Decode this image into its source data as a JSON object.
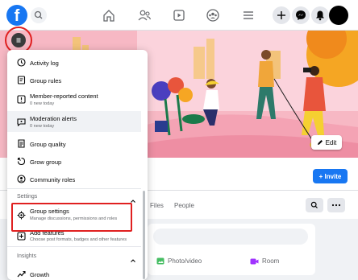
{
  "topbar": {
    "logo_letter": "f",
    "icons": [
      "search-icon",
      "home-icon",
      "friends-icon",
      "video-icon",
      "groups-icon",
      "menu-icon",
      "plus-icon",
      "messenger-icon",
      "notifications-icon"
    ]
  },
  "banner": {
    "edit_label": "Edit"
  },
  "group": {
    "invite_label": "+ Invite",
    "tabs": [
      "Files",
      "People"
    ],
    "composer_actions": [
      {
        "icon": "photo-video-icon",
        "label": "Photo/video",
        "color": "#45bd62"
      },
      {
        "icon": "room-icon",
        "label": "Room",
        "color": "#a033ff"
      }
    ]
  },
  "menu": {
    "items": [
      {
        "icon": "activity-log-icon",
        "title": "Activity log",
        "sub": ""
      },
      {
        "icon": "group-rules-icon",
        "title": "Group rules",
        "sub": ""
      },
      {
        "icon": "member-reported-icon",
        "title": "Member-reported content",
        "sub": "0 new today"
      },
      {
        "icon": "moderation-alerts-icon",
        "title": "Moderation alerts",
        "sub": "0 new today"
      },
      {
        "icon": "group-quality-icon",
        "title": "Group quality",
        "sub": ""
      },
      {
        "icon": "grow-group-icon",
        "title": "Grow group",
        "sub": ""
      },
      {
        "icon": "community-roles-icon",
        "title": "Community roles",
        "sub": ""
      }
    ],
    "settings_section": "Settings",
    "settings_items": [
      {
        "icon": "gear-icon",
        "title": "Group settings",
        "sub": "Manage discussions, permissions and roles"
      },
      {
        "icon": "add-features-icon",
        "title": "Add features",
        "sub": "Choose post formats, badges and other features"
      }
    ],
    "insights_section": "Insights",
    "insights_items": [
      {
        "icon": "growth-icon",
        "title": "Growth",
        "sub": ""
      }
    ]
  },
  "colors": {
    "brand": "#1877f2",
    "highlight_outline": "#e02020"
  }
}
